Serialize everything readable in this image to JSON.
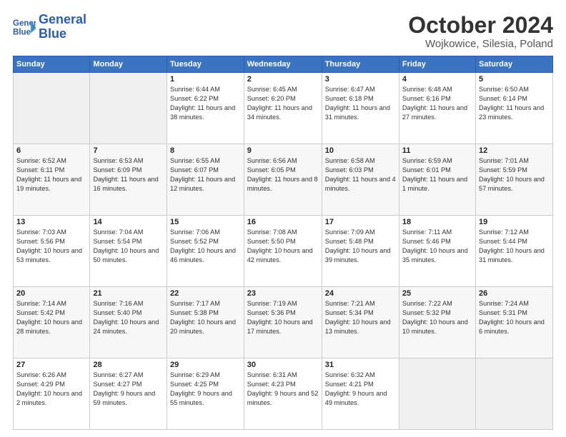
{
  "header": {
    "logo_line1": "General",
    "logo_line2": "Blue",
    "month": "October 2024",
    "location": "Wojkowice, Silesia, Poland"
  },
  "columns": [
    "Sunday",
    "Monday",
    "Tuesday",
    "Wednesday",
    "Thursday",
    "Friday",
    "Saturday"
  ],
  "rows": [
    [
      {
        "day": "",
        "text": ""
      },
      {
        "day": "",
        "text": ""
      },
      {
        "day": "1",
        "text": "Sunrise: 6:44 AM\nSunset: 6:22 PM\nDaylight: 11 hours and 38 minutes."
      },
      {
        "day": "2",
        "text": "Sunrise: 6:45 AM\nSunset: 6:20 PM\nDaylight: 11 hours and 34 minutes."
      },
      {
        "day": "3",
        "text": "Sunrise: 6:47 AM\nSunset: 6:18 PM\nDaylight: 11 hours and 31 minutes."
      },
      {
        "day": "4",
        "text": "Sunrise: 6:48 AM\nSunset: 6:16 PM\nDaylight: 11 hours and 27 minutes."
      },
      {
        "day": "5",
        "text": "Sunrise: 6:50 AM\nSunset: 6:14 PM\nDaylight: 11 hours and 23 minutes."
      }
    ],
    [
      {
        "day": "6",
        "text": "Sunrise: 6:52 AM\nSunset: 6:11 PM\nDaylight: 11 hours and 19 minutes."
      },
      {
        "day": "7",
        "text": "Sunrise: 6:53 AM\nSunset: 6:09 PM\nDaylight: 11 hours and 16 minutes."
      },
      {
        "day": "8",
        "text": "Sunrise: 6:55 AM\nSunset: 6:07 PM\nDaylight: 11 hours and 12 minutes."
      },
      {
        "day": "9",
        "text": "Sunrise: 6:56 AM\nSunset: 6:05 PM\nDaylight: 11 hours and 8 minutes."
      },
      {
        "day": "10",
        "text": "Sunrise: 6:58 AM\nSunset: 6:03 PM\nDaylight: 11 hours and 4 minutes."
      },
      {
        "day": "11",
        "text": "Sunrise: 6:59 AM\nSunset: 6:01 PM\nDaylight: 11 hours and 1 minute."
      },
      {
        "day": "12",
        "text": "Sunrise: 7:01 AM\nSunset: 5:59 PM\nDaylight: 10 hours and 57 minutes."
      }
    ],
    [
      {
        "day": "13",
        "text": "Sunrise: 7:03 AM\nSunset: 5:56 PM\nDaylight: 10 hours and 53 minutes."
      },
      {
        "day": "14",
        "text": "Sunrise: 7:04 AM\nSunset: 5:54 PM\nDaylight: 10 hours and 50 minutes."
      },
      {
        "day": "15",
        "text": "Sunrise: 7:06 AM\nSunset: 5:52 PM\nDaylight: 10 hours and 46 minutes."
      },
      {
        "day": "16",
        "text": "Sunrise: 7:08 AM\nSunset: 5:50 PM\nDaylight: 10 hours and 42 minutes."
      },
      {
        "day": "17",
        "text": "Sunrise: 7:09 AM\nSunset: 5:48 PM\nDaylight: 10 hours and 39 minutes."
      },
      {
        "day": "18",
        "text": "Sunrise: 7:11 AM\nSunset: 5:46 PM\nDaylight: 10 hours and 35 minutes."
      },
      {
        "day": "19",
        "text": "Sunrise: 7:12 AM\nSunset: 5:44 PM\nDaylight: 10 hours and 31 minutes."
      }
    ],
    [
      {
        "day": "20",
        "text": "Sunrise: 7:14 AM\nSunset: 5:42 PM\nDaylight: 10 hours and 28 minutes."
      },
      {
        "day": "21",
        "text": "Sunrise: 7:16 AM\nSunset: 5:40 PM\nDaylight: 10 hours and 24 minutes."
      },
      {
        "day": "22",
        "text": "Sunrise: 7:17 AM\nSunset: 5:38 PM\nDaylight: 10 hours and 20 minutes."
      },
      {
        "day": "23",
        "text": "Sunrise: 7:19 AM\nSunset: 5:36 PM\nDaylight: 10 hours and 17 minutes."
      },
      {
        "day": "24",
        "text": "Sunrise: 7:21 AM\nSunset: 5:34 PM\nDaylight: 10 hours and 13 minutes."
      },
      {
        "day": "25",
        "text": "Sunrise: 7:22 AM\nSunset: 5:32 PM\nDaylight: 10 hours and 10 minutes."
      },
      {
        "day": "26",
        "text": "Sunrise: 7:24 AM\nSunset: 5:31 PM\nDaylight: 10 hours and 6 minutes."
      }
    ],
    [
      {
        "day": "27",
        "text": "Sunrise: 6:26 AM\nSunset: 4:29 PM\nDaylight: 10 hours and 2 minutes."
      },
      {
        "day": "28",
        "text": "Sunrise: 6:27 AM\nSunset: 4:27 PM\nDaylight: 9 hours and 59 minutes."
      },
      {
        "day": "29",
        "text": "Sunrise: 6:29 AM\nSunset: 4:25 PM\nDaylight: 9 hours and 55 minutes."
      },
      {
        "day": "30",
        "text": "Sunrise: 6:31 AM\nSunset: 4:23 PM\nDaylight: 9 hours and 52 minutes."
      },
      {
        "day": "31",
        "text": "Sunrise: 6:32 AM\nSunset: 4:21 PM\nDaylight: 9 hours and 49 minutes."
      },
      {
        "day": "",
        "text": ""
      },
      {
        "day": "",
        "text": ""
      }
    ]
  ]
}
